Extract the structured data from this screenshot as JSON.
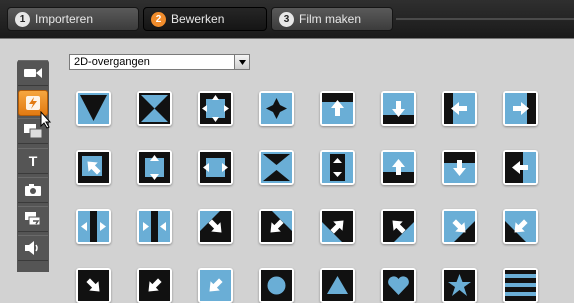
{
  "tabs": [
    {
      "number": "1",
      "label": "Importeren",
      "active": false
    },
    {
      "number": "2",
      "label": "Bewerken",
      "active": true
    },
    {
      "number": "3",
      "label": "Film maken",
      "active": false
    }
  ],
  "sidebar": {
    "items": [
      {
        "name": "video-icon"
      },
      {
        "name": "transition-icon",
        "active": true
      },
      {
        "name": "title-overlay-icon"
      },
      {
        "name": "text-icon",
        "glyph": "T"
      },
      {
        "name": "camera-icon"
      },
      {
        "name": "effects-icon"
      },
      {
        "name": "audio-icon"
      }
    ]
  },
  "dropdown": {
    "selected": "2D-overgangen"
  },
  "transitions": [
    "wipe-down",
    "split-diagonal",
    "expand-arrows",
    "iris-star",
    "slide-up-bar",
    "push-down",
    "push-left",
    "push-right",
    "corner-in-topleft",
    "expand-vertical",
    "expand-horizontal",
    "contract-vertical",
    "shrink-vertical",
    "arrow-up",
    "arrow-down",
    "arrow-left",
    "converge-horizontal",
    "diverge-horizontal",
    "arrow-down-right",
    "arrow-down-left",
    "arrow-up-right",
    "arrow-up-left",
    "arrow-down-right-2",
    "arrow-down-left-2",
    "arrow-down-right-3",
    "arrow-down-left-3",
    "arrow-down-left-4",
    "circle-reveal",
    "triangle-up",
    "heart-reveal",
    "star-reveal",
    "bars-horizontal"
  ],
  "colors": {
    "accent": "#f08c2c",
    "tile_blue": "#6aaed6",
    "tile_dark": "#111111"
  }
}
